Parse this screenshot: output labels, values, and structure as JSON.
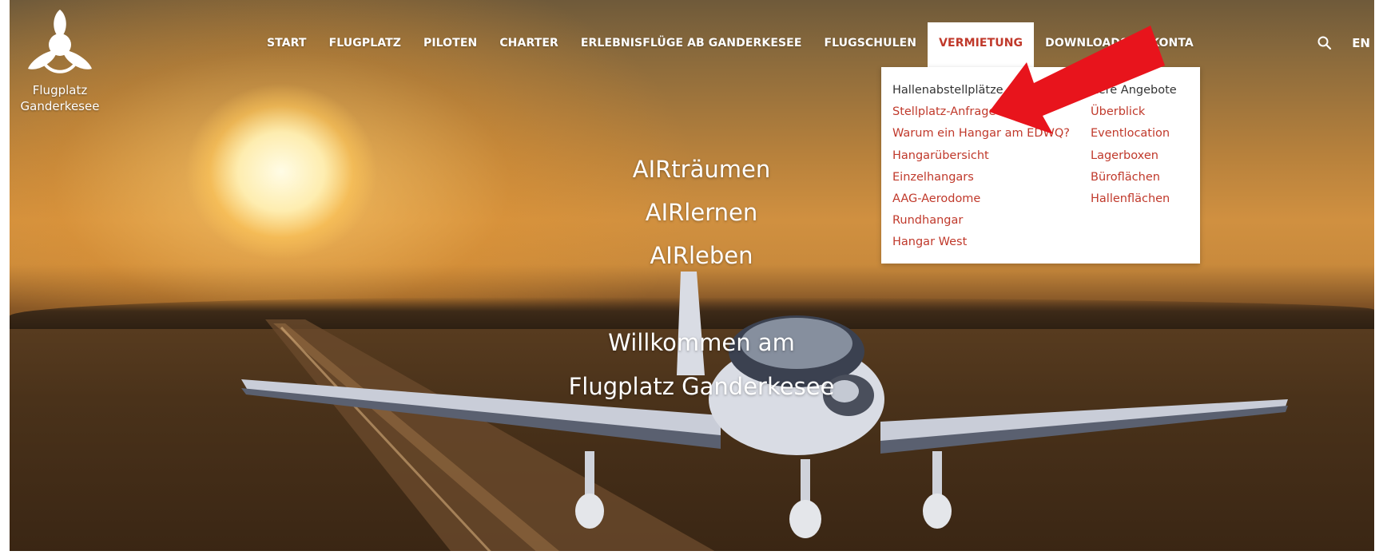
{
  "logo": {
    "line1": "Flugplatz",
    "line2": "Ganderkesee"
  },
  "nav": {
    "items": [
      "START",
      "FLUGPLATZ",
      "PILOTEN",
      "CHARTER",
      "ERLEBNISFLÜGE AB GANDERKESEE",
      "FLUGSCHULEN",
      "VERMIETUNG",
      "DOWNLOADS",
      "KONTA"
    ],
    "active": "VERMIETUNG",
    "language": "EN"
  },
  "dropdown": {
    "left_column": {
      "heading": "Hallenabstellplätze",
      "items": [
        "Stellplatz-Anfrage",
        "Warum ein Hangar am EDWQ?",
        "Hangarübersicht",
        "Einzelhangars",
        "AAG-Aerodome",
        "Rundhangar",
        "Hangar West"
      ]
    },
    "right_column": {
      "heading": "itere Angebote",
      "items": [
        "Überblick",
        "Eventlocation",
        "Lagerboxen",
        "Büroflächen",
        "Hallenflächen"
      ]
    }
  },
  "hero": {
    "lines": [
      "AIRträumen",
      "AIRlernen",
      "AIRleben"
    ],
    "welcome": [
      "Willkommen am",
      "Flugplatz Ganderkesee"
    ]
  },
  "colors": {
    "accent": "#c0392b",
    "arrow": "#e8141c"
  },
  "icons": {
    "search": "search-icon",
    "logo": "propeller-logo-icon"
  }
}
